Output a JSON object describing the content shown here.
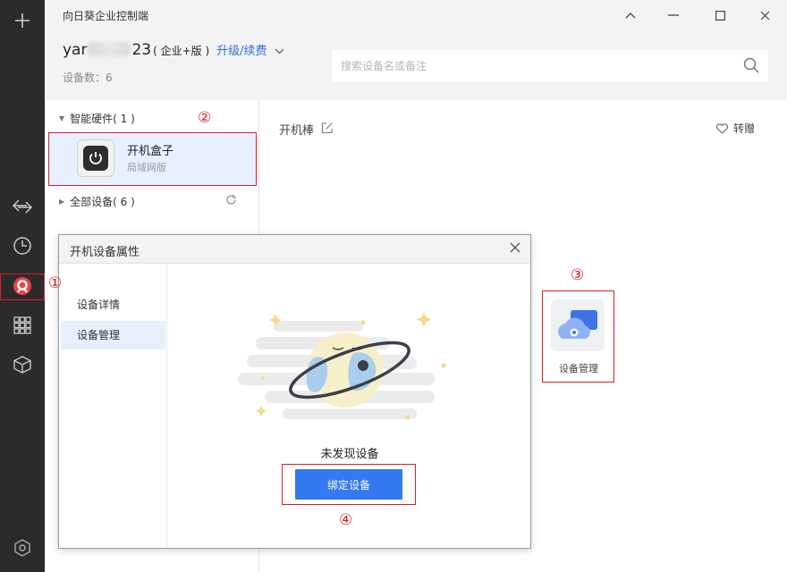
{
  "app": {
    "title": "向日葵企业控制端"
  },
  "window_controls": {
    "collapse_icon": "chevron-up-icon",
    "minimize_icon": "minimize-icon",
    "maximize_icon": "maximize-icon",
    "close_icon": "close-icon"
  },
  "rail": {
    "items": [
      {
        "name": "add-icon"
      },
      {
        "name": "remote-control-icon"
      },
      {
        "name": "history-icon"
      },
      {
        "name": "boot-device-icon",
        "active": true
      },
      {
        "name": "apps-grid-icon"
      },
      {
        "name": "cube-icon"
      },
      {
        "name": "settings-hex-icon"
      }
    ]
  },
  "account": {
    "prefix": "yar",
    "suffix": "23",
    "edition": "( 企业+版 )",
    "upgrade_link": "升级/续费",
    "device_count": "设备数：6"
  },
  "search": {
    "placeholder": "搜索设备名或备注"
  },
  "tree": {
    "smart_hardware": "智能硬件( 1 )",
    "all_devices": "全部设备( 6 )",
    "selected_device": {
      "name": "开机盒子",
      "subtitle": "局域网版"
    }
  },
  "pane": {
    "title": "开机棒",
    "transfer": "转赠",
    "mgmt_tile_label": "设备管理"
  },
  "dialog": {
    "title": "开机设备属性",
    "nav": [
      {
        "label": "设备详情"
      },
      {
        "label": "设备管理"
      }
    ],
    "active_nav": 1,
    "empty_text": "未发现设备",
    "bind_button": "绑定设备"
  },
  "annotations": {
    "n1": "①",
    "n2": "②",
    "n3": "③",
    "n4": "④",
    "color": "#d61f26"
  },
  "colors": {
    "accent": "#3478f2",
    "link": "#2f6fe8",
    "rail": "#2b2b2b",
    "selected": "#e7f0fc"
  }
}
